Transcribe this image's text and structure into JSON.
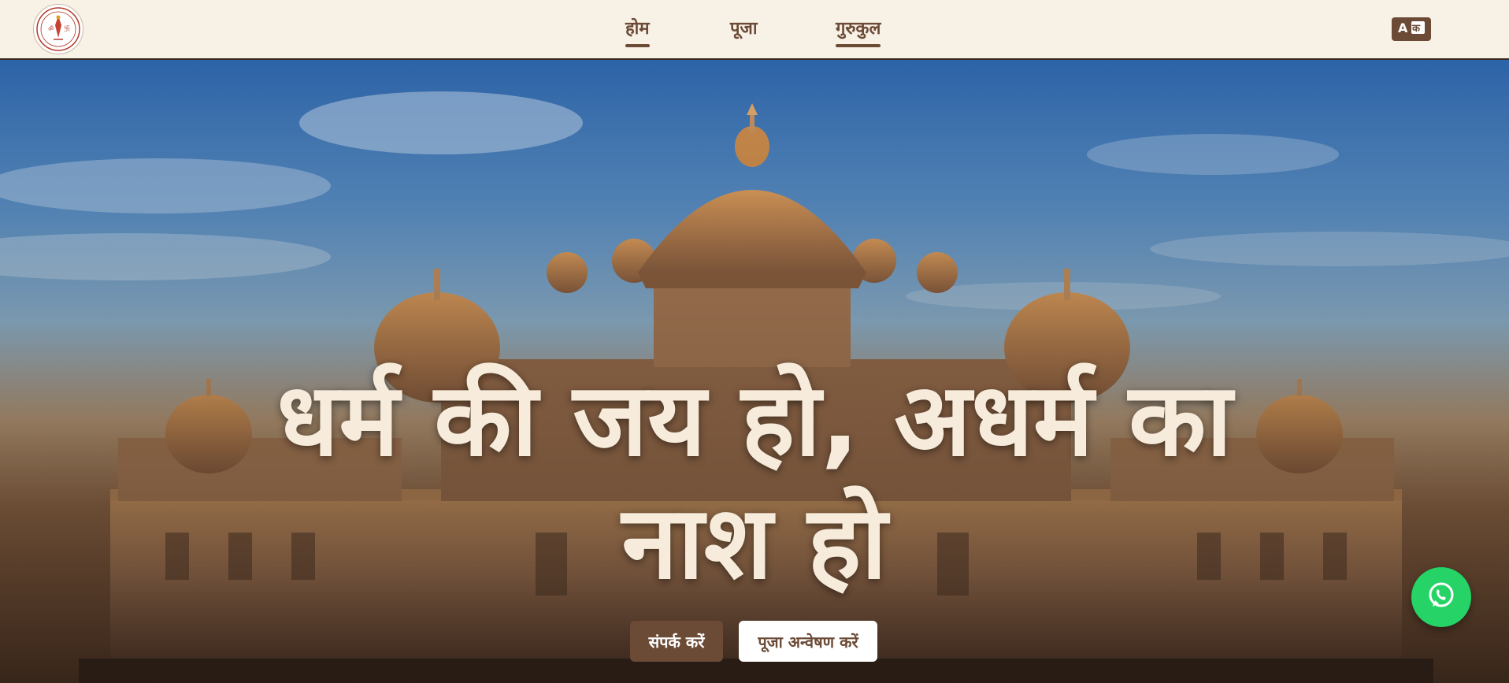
{
  "header": {
    "logo_icon": "temple-logo-icon",
    "nav": [
      {
        "label": "होम",
        "active": true
      },
      {
        "label": "पूजा",
        "active": false
      },
      {
        "label": "गुरुकुल",
        "active": true
      }
    ],
    "language_icon": "translate-icon"
  },
  "hero": {
    "title": "धर्म की जय हो, अधर्म का नाश हो",
    "background": "temple-at-dusk-image",
    "buttons": {
      "contact": "संपर्क करें",
      "explore_puja": "पूजा अन्वेषण करें"
    }
  },
  "floating": {
    "whatsapp_icon": "whatsapp-icon"
  },
  "colors": {
    "header_bg": "#f8f1e6",
    "brand_brown": "#6b4a36",
    "title_cream": "#f7ecdc",
    "whatsapp_green": "#25d366"
  }
}
